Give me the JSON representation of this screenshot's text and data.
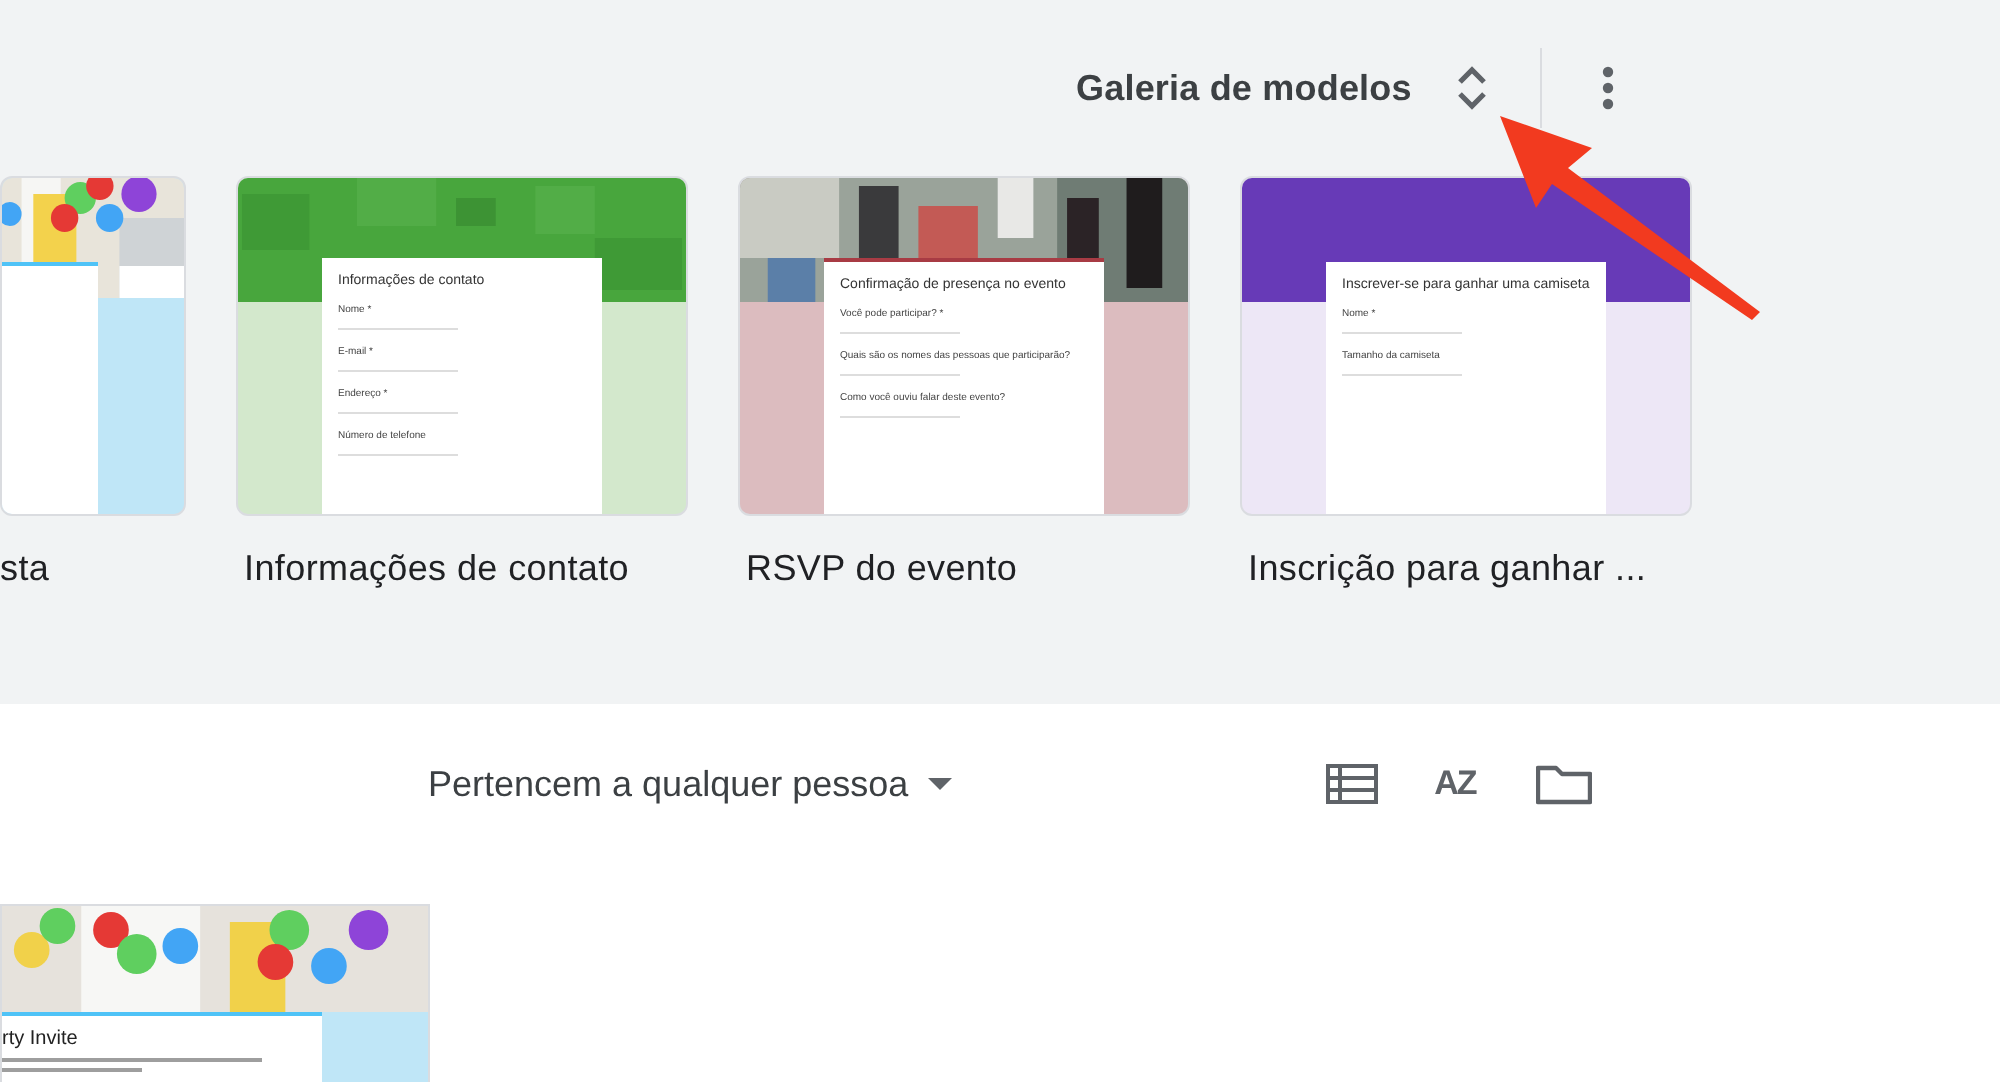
{
  "header": {
    "title": "Galeria de modelos"
  },
  "templates": [
    {
      "kind": "balloons",
      "label": "sta"
    },
    {
      "kind": "contact",
      "label": "Informações de contato",
      "form": {
        "title": "Informações de contato",
        "fields": [
          "Nome *",
          "E-mail *",
          "Endereço *",
          "Número de telefone"
        ]
      }
    },
    {
      "kind": "rsvp",
      "label": "RSVP do evento",
      "form": {
        "title": "Confirmação de presença no evento",
        "fields": [
          "Você pode participar? *",
          "Quais são os nomes das pessoas que participarão?",
          "Como você ouviu falar deste evento?"
        ]
      }
    },
    {
      "kind": "tshirt",
      "label": "Inscrição para ganhar ...",
      "form": {
        "title": "Inscrever-se para ganhar uma camiseta",
        "fields": [
          "Nome *",
          "Tamanho da camiseta"
        ]
      }
    }
  ],
  "controls": {
    "owner_filter": "Pertencem a qualquer pessoa",
    "sort_label": "AZ"
  },
  "documents": [
    {
      "kind": "balloons",
      "title": "rty Invite"
    }
  ]
}
